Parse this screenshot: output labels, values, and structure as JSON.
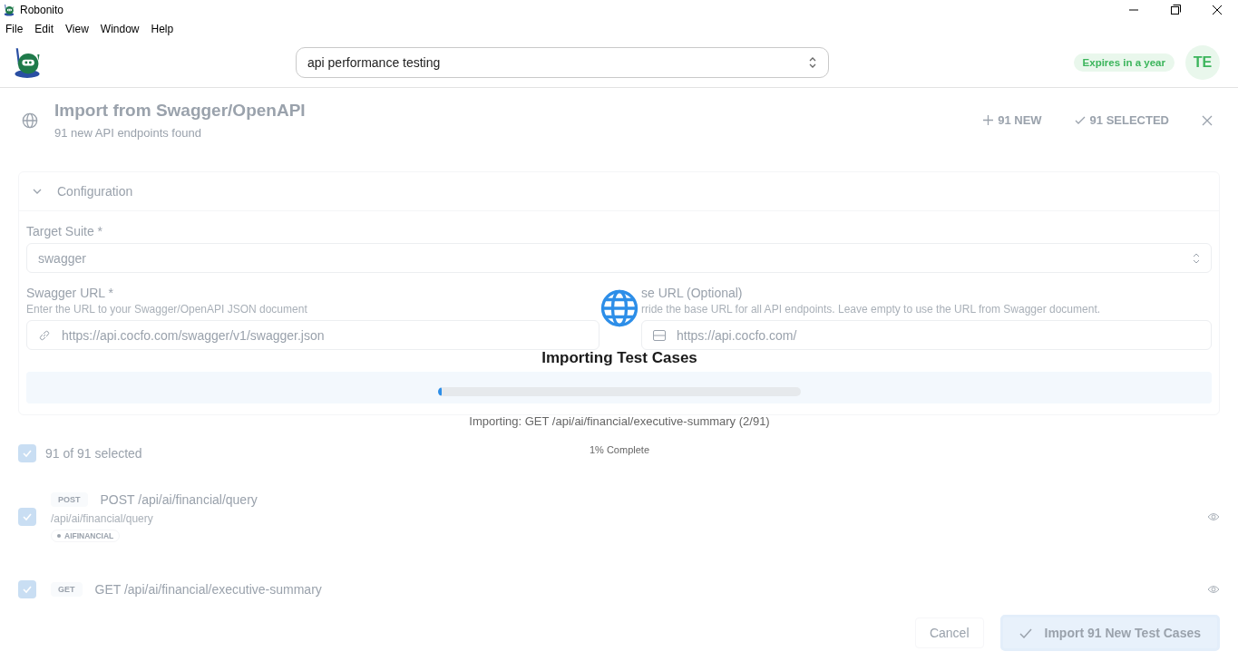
{
  "window": {
    "title": "Robonito"
  },
  "menu": [
    "File",
    "Edit",
    "View",
    "Window",
    "Help"
  ],
  "header": {
    "search": {
      "value": "api performance testing"
    },
    "license": "Expires in a year",
    "avatar": "TE"
  },
  "dialog": {
    "title": "Import from Swagger/OpenAPI",
    "subtitle": "91 new API endpoints found",
    "new_count": "91 NEW",
    "selected_count": "91 SELECTED",
    "configuration": {
      "title": "Configuration",
      "expanded": true,
      "target_suite": {
        "label": "Target Suite *",
        "value": "swagger"
      },
      "swagger_url": {
        "label": "Swagger URL *",
        "help": "Enter the URL to your Swagger/OpenAPI JSON document",
        "value": "https://api.cocfo.com/swagger/v1/swagger.json"
      },
      "base_url": {
        "label": "se URL (Optional)",
        "help": "rride the base URL for all API endpoints. Leave empty to use the URL from Swagger document.",
        "value": "https://api.cocfo.com/"
      }
    },
    "selection": {
      "label": "91 of 91 selected",
      "checked": true
    },
    "endpoints": [
      {
        "method": "POST",
        "title": "POST /api/ai/financial/query",
        "path": "/api/ai/financial/query",
        "tag": "AIFINANCIAL",
        "checked": true
      },
      {
        "method": "GET",
        "title": "GET /api/ai/financial/executive-summary",
        "checked": true
      }
    ],
    "buttons": {
      "cancel": "Cancel",
      "import": "Import 91 New Test Cases"
    }
  },
  "progress": {
    "title": "Importing Test Cases",
    "level": 0.01,
    "status": "Importing: GET /api/ai/financial/executive-summary (2/91)",
    "percent": "1% Complete"
  }
}
